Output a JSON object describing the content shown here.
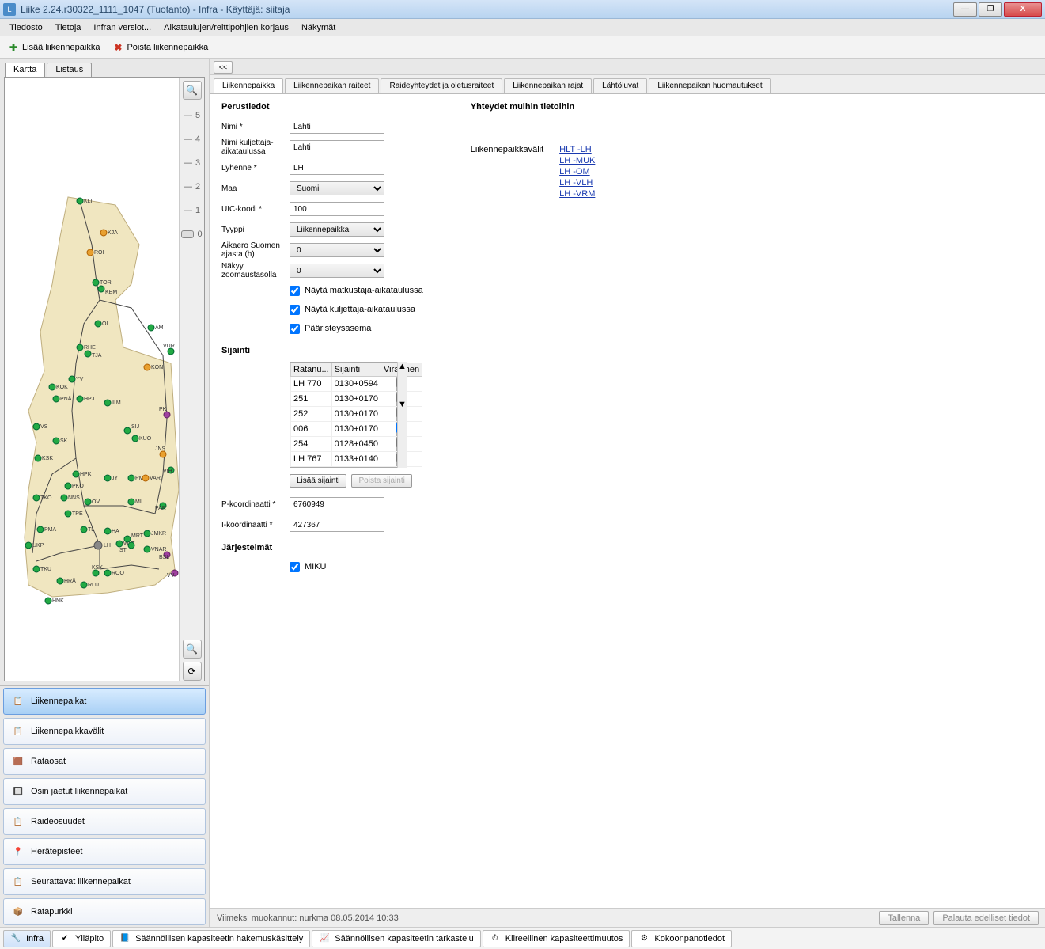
{
  "title": "Liike 2.24.r30322_1111_1047 (Tuotanto) - Infra - Käyttäjä: siitaja",
  "menu": [
    "Tiedosto",
    "Tietoja",
    "Infran versiot...",
    "Aikataulujen/reittipohjien korjaus",
    "Näkymät"
  ],
  "toolbar": {
    "add": "Lisää liikennepaikka",
    "del": "Poista liikennepaikka"
  },
  "left": {
    "tabs": [
      "Kartta",
      "Listaus"
    ],
    "slider_ticks": [
      "5",
      "4",
      "3",
      "2",
      "1",
      "0"
    ],
    "nav": [
      "Liikennepaikat",
      "Liikennepaikkavälit",
      "Rataosat",
      "Osin jaetut liikennepaikat",
      "Raideosuudet",
      "Herätepisteet",
      "Seurattavat liikennepaikat",
      "Ratapurkki"
    ],
    "map_labels": [
      "KLI",
      "KJÄ",
      "ROI",
      "TOR",
      "KEM",
      "OL",
      "ÄM",
      "RHE",
      "TJA",
      "VUR",
      "KON",
      "YV",
      "KOK",
      "PNÄ",
      "HPJ",
      "ILM",
      "PK",
      "VS",
      "SIJ",
      "KUO",
      "SK",
      "KSK",
      "JNS",
      "VIH",
      "HPK",
      "PKO",
      "JY",
      "PM",
      "VAR",
      "TKO",
      "NNS",
      "OV",
      "MI",
      "PAR",
      "TPE",
      "PMA",
      "TL",
      "HA",
      "JMKR",
      "UKP",
      "LH",
      "WLT",
      "VNAR",
      "BSL",
      "ST",
      "MRT",
      "TKU",
      "KSK",
      "HRÄ",
      "RLU",
      "ROO",
      "VV",
      "HNK"
    ]
  },
  "right": {
    "tabs": [
      "Liikennepaikka",
      "Liikennepaikan raiteet",
      "Raideyhteydet ja oletusraiteet",
      "Liikennepaikan rajat",
      "Lähtöluvat",
      "Liikennepaikan huomautukset"
    ],
    "section_basic": "Perustiedot",
    "labels": {
      "nimi": "Nimi *",
      "nimi_kulj": "Nimi kuljettaja-aikataulussa",
      "lyhenne": "Lyhenne *",
      "maa": "Maa",
      "uic": "UIC-koodi *",
      "tyyppi": "Tyyppi",
      "aikaero": "Aikaero Suomen ajasta (h)",
      "zoom": "Näkyy zoomaustasolla",
      "chk1": "Näytä matkustaja-aikataulussa",
      "chk2": "Näytä kuljettaja-aikataulussa",
      "chk3": "Pääristeysasema",
      "sijainti": "Sijainti",
      "pkoord": "P-koordinaatti *",
      "ikoord": "I-koordinaatti *",
      "jarj": "Järjestelmät",
      "miku": "MIKU"
    },
    "values": {
      "nimi": "Lahti",
      "nimi_kulj": "Lahti",
      "lyhenne": "LH",
      "maa": "Suomi",
      "uic": "100",
      "tyyppi": "Liikennepaikka",
      "aikaero": "0",
      "zoom": "0",
      "pkoord": "6760949",
      "ikoord": "427367"
    },
    "sij_table": {
      "headers": [
        "Ratanu...",
        "Sijainti",
        "Virallinen"
      ],
      "rows": [
        {
          "r": "LH 770",
          "s": "0130+0594",
          "v": false
        },
        {
          "r": "251",
          "s": "0130+0170",
          "v": false
        },
        {
          "r": "252",
          "s": "0130+0170",
          "v": false
        },
        {
          "r": "006",
          "s": "0130+0170",
          "v": true
        },
        {
          "r": "254",
          "s": "0128+0450",
          "v": false
        },
        {
          "r": "LH 767",
          "s": "0133+0140",
          "v": false
        }
      ],
      "add_btn": "Lisää sijainti",
      "del_btn": "Poista sijainti"
    },
    "yhteydet": {
      "header": "Yhteydet muihin tietoihin",
      "label": "Liikennepaikkavälit",
      "links": [
        "HLT -LH",
        "LH -MUK",
        "LH -OM",
        "LH -VLH",
        "LH -VRM"
      ]
    },
    "footer": {
      "last_edit": "Viimeksi muokannut: nurkma 08.05.2014 10:33",
      "save": "Tallenna",
      "revert": "Palauta edelliset tiedot"
    }
  },
  "statusbar": [
    "Infra",
    "Ylläpito",
    "Säännöllisen kapasiteetin hakemuskäsittely",
    "Säännöllisen kapasiteetin tarkastelu",
    "Kiireellinen kapasiteettimuutos",
    "Kokoonpanotiedot"
  ]
}
